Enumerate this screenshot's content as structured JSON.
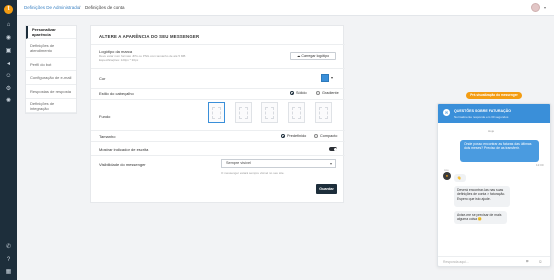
{
  "rail": {
    "logo": "t",
    "icons": [
      "home-icon",
      "chat-icon",
      "contacts-icon",
      "megaphone-icon",
      "bot-icon",
      "settings-icon",
      "phone-icon",
      "help-icon",
      "grid-icon"
    ]
  },
  "breadcrumb": {
    "parent": "Definições De Administrador",
    "separator": "/",
    "current": "Definições de conta"
  },
  "submenu": [
    {
      "label": "Personalizar aparência",
      "active": true
    },
    {
      "label": "Definições de atendimento"
    },
    {
      "label": "Perfil do bot"
    },
    {
      "label": "Configuração de e-mail"
    },
    {
      "label": "Respostas de resposta"
    },
    {
      "label": "Definições de integração"
    }
  ],
  "card": {
    "title": "ALTERE A APARÊNCIA DO SEU MESSENGER",
    "logo_label": "Logótipo da marca",
    "logo_hint_1": "Deve estar num formato JPG ou PNG com tamanho de até 5 MB",
    "logo_hint_2": "Especificações: 120px * 30px",
    "upload_label": "Carregar logótipo",
    "color_label": "Cor",
    "header_label": "Estilo do cabeçalho",
    "header_options": [
      "Sólido",
      "Gradiente"
    ],
    "header_selected": "Sólido",
    "background_label": "Fundo",
    "size_label": "Tamanho",
    "size_options": [
      "Predefinido",
      "Compacto"
    ],
    "size_selected": "Predefinido",
    "typing_label": "Mostrar indicador de escrita",
    "typing_on": true,
    "visibility_label": "Visibilidade do messenger",
    "visibility_value": "Sempre visível",
    "visibility_hint": "O messenger estará sempre visível no seu site.",
    "save_label": "Guardar",
    "accent": "#3a8fd9",
    "dark": "#1d2e3b"
  },
  "preview_chip": "Pré-visualização do messenger",
  "widget": {
    "title": "QUESTÕES SOBRE FATURAÇÃO",
    "subtitle": "Normalmente responde em 30 segundos",
    "day": "Hoje",
    "outgoing": "Onde posso encontrar as faturas das últimas dois meses? Preciso de as transferir.",
    "outgoing_time": "12:00",
    "agent_name": "Ana",
    "incoming": [
      "👋",
      "Deverá encontrar-las nas suas definições de conta > faturação. Espero que isto ajude.",
      "Avise-me se precisar de mais alguma coisa 😊"
    ],
    "input_placeholder": "Responda aqui..."
  }
}
